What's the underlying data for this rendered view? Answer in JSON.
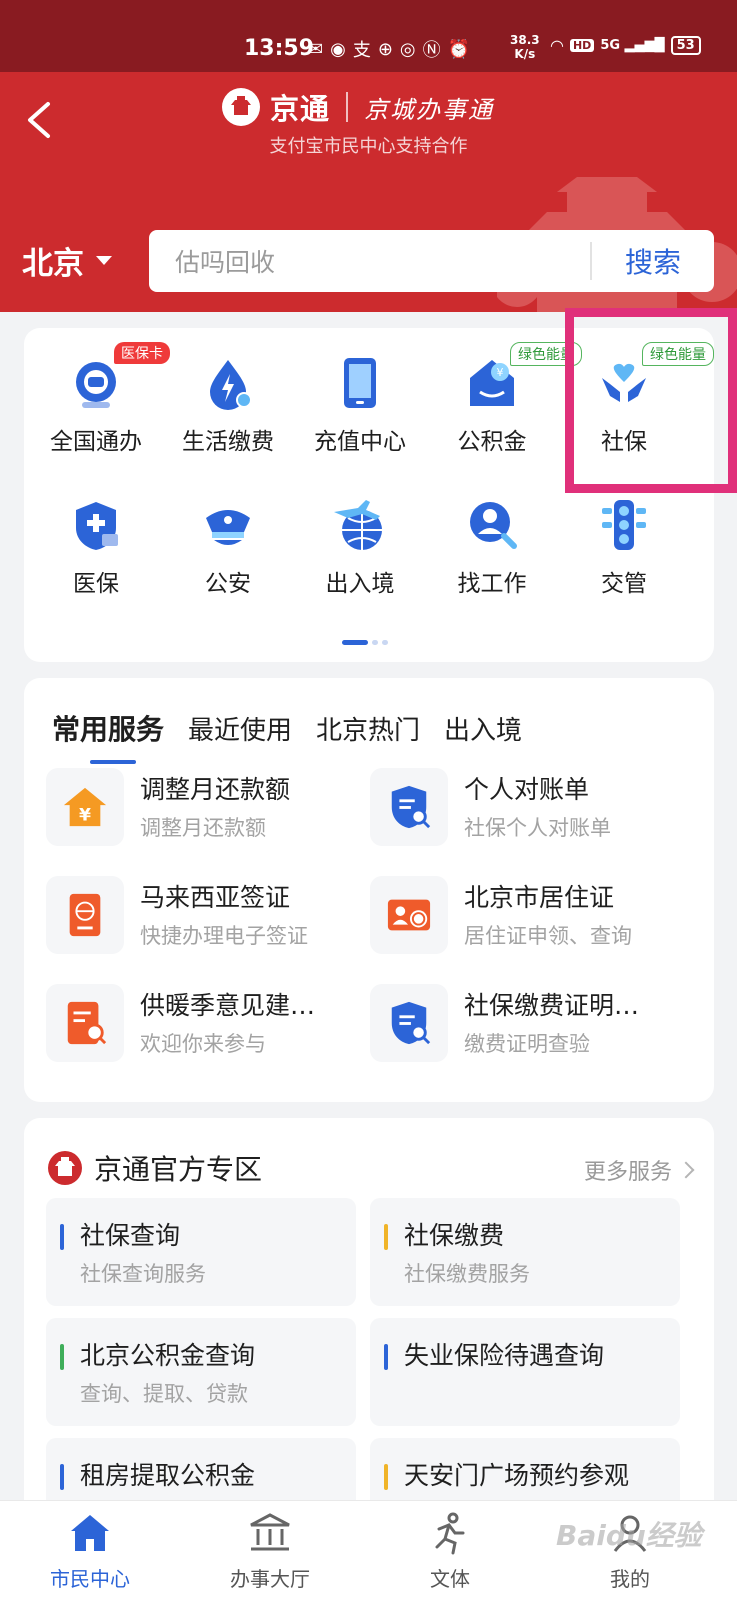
{
  "status_bar": {
    "time": "13:59",
    "speed_value": "38.3",
    "speed_unit": "K/s",
    "hd": "HD",
    "network": "5G",
    "battery": "53"
  },
  "header": {
    "brand_name": "京通",
    "brand_sub": "京城办事通",
    "subtitle": "支付宝市民中心支持合作",
    "city": "北京",
    "search_placeholder": "估吗回收",
    "search_button": "搜索"
  },
  "grid": [
    {
      "label": "全国通办",
      "tag": "医保卡",
      "tag_style": "red",
      "icon": "globe-service-icon"
    },
    {
      "label": "生活缴费",
      "tag": "",
      "icon": "water-bolt-icon"
    },
    {
      "label": "充值中心",
      "tag": "",
      "icon": "phone-icon"
    },
    {
      "label": "公积金",
      "tag": "绿色能量",
      "tag_style": "green",
      "icon": "house-fund-icon"
    },
    {
      "label": "社保",
      "tag": "绿色能量",
      "tag_style": "green",
      "icon": "hands-heart-icon"
    },
    {
      "label": "医保",
      "tag": "",
      "icon": "medical-shield-icon"
    },
    {
      "label": "公安",
      "tag": "",
      "icon": "police-cap-icon"
    },
    {
      "label": "出入境",
      "tag": "",
      "icon": "plane-globe-icon"
    },
    {
      "label": "找工作",
      "tag": "",
      "icon": "job-search-icon"
    },
    {
      "label": "交管",
      "tag": "",
      "icon": "traffic-light-icon"
    }
  ],
  "tabs": [
    "常用服务",
    "最近使用",
    "北京热门",
    "出入境"
  ],
  "services": [
    {
      "title": "调整月还款额",
      "desc": "调整月还款额",
      "icon": "house-yuan-icon"
    },
    {
      "title": "个人对账单",
      "desc": "社保个人对账单",
      "icon": "doc-search-icon"
    },
    {
      "title": "马来西亚签证",
      "desc": "快捷办理电子签证",
      "icon": "passport-icon"
    },
    {
      "title": "北京市居住证",
      "desc": "居住证申领、查询",
      "icon": "id-card-icon"
    },
    {
      "title": "供暖季意见建…",
      "desc": "欢迎你来参与",
      "icon": "feedback-doc-icon"
    },
    {
      "title": "社保缴费证明…",
      "desc": "缴费证明查验",
      "icon": "doc-search-icon"
    }
  ],
  "zone": {
    "title": "京通官方专区",
    "more": "更多服务",
    "items": [
      {
        "title": "社保查询",
        "desc": "社保查询服务",
        "accent": "#2c64d7"
      },
      {
        "title": "社保缴费",
        "desc": "社保缴费服务",
        "accent": "#f0b429"
      },
      {
        "title": "北京公积金查询",
        "desc": "查询、提取、贷款",
        "accent": "#3fae5a"
      },
      {
        "title": "失业保险待遇查询",
        "desc": "",
        "accent": "#2c64d7"
      },
      {
        "title": "租房提取公积金",
        "desc": "",
        "accent": "#2c64d7"
      },
      {
        "title": "天安门广场预约参观",
        "desc": "",
        "accent": "#f0b429"
      }
    ]
  },
  "bottom_nav": [
    {
      "label": "市民中心",
      "active": true
    },
    {
      "label": "办事大厅",
      "active": false
    },
    {
      "label": "文体",
      "active": false
    },
    {
      "label": "我的",
      "active": false
    }
  ],
  "watermark": "Baidu经验",
  "colors": {
    "primary": "#2c64d7",
    "header_red": "#cc2b2e",
    "status_red": "#891b21",
    "highlight": "#e0307a"
  }
}
